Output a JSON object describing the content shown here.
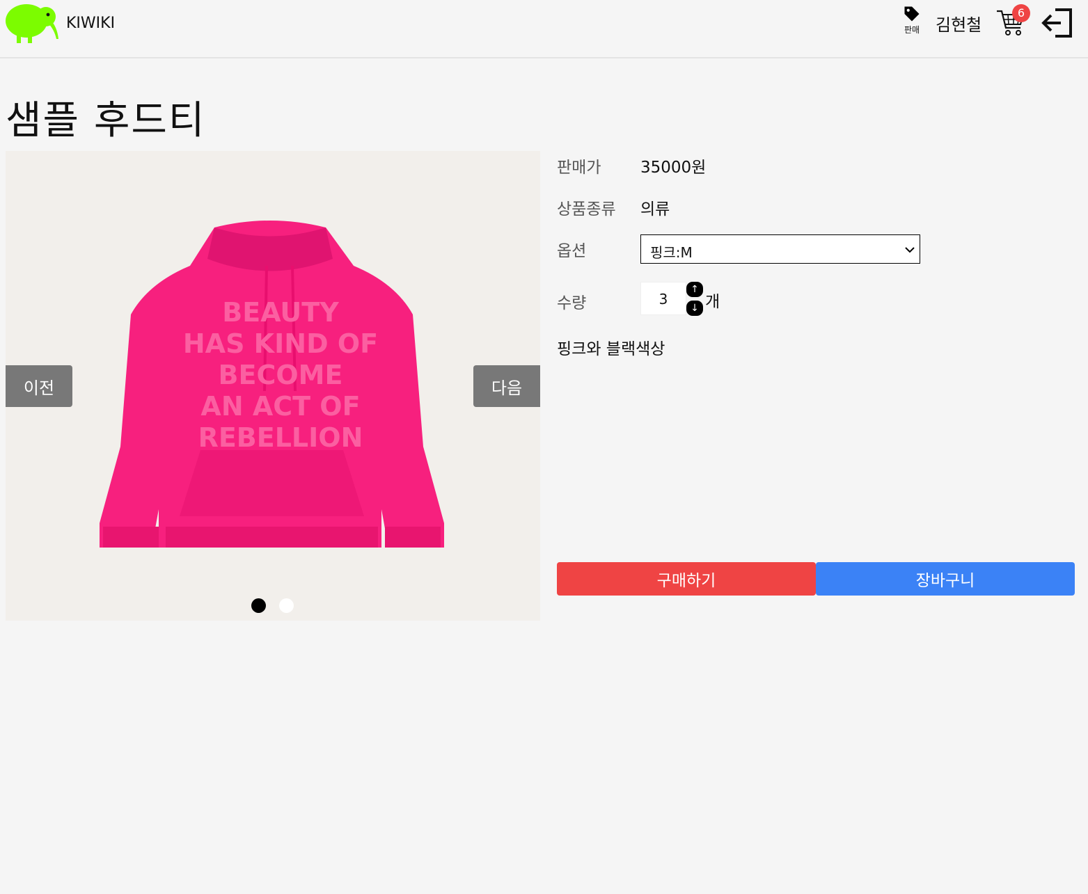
{
  "header": {
    "brand": "KIWIKI",
    "sell_label": "판매",
    "username": "김현철",
    "cart_count": "6",
    "icons": [
      "kiwi-logo-icon",
      "tag-icon",
      "cart-icon",
      "logout-icon"
    ]
  },
  "product": {
    "title": "샘플 후드티",
    "price_label": "판매가",
    "price": "35000원",
    "category_label": "상품종류",
    "category": "의류",
    "option_label": "옵션",
    "option_selected": "핑크:M",
    "quantity_label": "수량",
    "quantity": "3",
    "quantity_unit": "개",
    "description": "핑크와 블랙색상",
    "hoodie_print": [
      "BEAUTY",
      "HAS KIND OF",
      "BECOME",
      "AN ACT OF",
      "REBELLION"
    ]
  },
  "gallery": {
    "prev_label": "이전",
    "next_label": "다음",
    "active_index": 0,
    "count": 2
  },
  "actions": {
    "buy_label": "구매하기",
    "cart_label": "장바구니"
  },
  "colors": {
    "logo": "#7cfc00",
    "buy": "#ef4444",
    "cart": "#3b82f6",
    "badge": "#ef4444",
    "hoodie": "#f7207e"
  }
}
